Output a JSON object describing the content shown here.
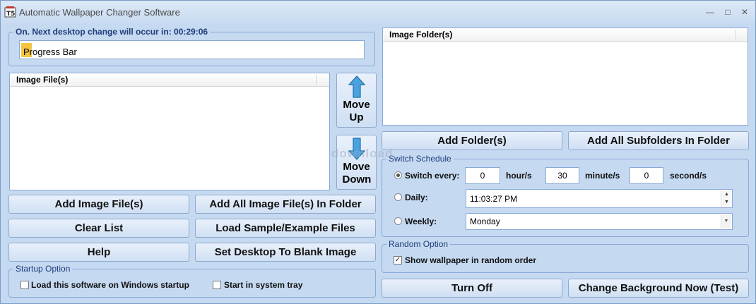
{
  "window": {
    "title": "Automatic Wallpaper Changer Software",
    "minimize_label": "—",
    "maximize_label": "□",
    "close_label": "✕"
  },
  "status_group": {
    "title": "On. Next desktop change will occur in: 00:29:06",
    "progress_text": "Progress Bar",
    "progress_fraction": 0.03
  },
  "image_files": {
    "header": "Image File(s)"
  },
  "move_buttons": {
    "up_label": "Move Up",
    "down_label": "Move Down"
  },
  "left_buttons": {
    "add_files": "Add Image File(s)",
    "add_all_in_folder": "Add All Image File(s) In Folder",
    "clear_list": "Clear List",
    "load_sample": "Load Sample/Example Files",
    "help": "Help",
    "set_blank": "Set Desktop To Blank Image"
  },
  "startup": {
    "title": "Startup Option",
    "load_on_startup_label": "Load this software on Windows startup",
    "load_on_startup_checked": false,
    "start_in_tray_label": "Start in system tray",
    "start_in_tray_checked": false
  },
  "image_folders": {
    "header": "Image Folder(s)"
  },
  "folder_buttons": {
    "add_folders": "Add Folder(s)",
    "add_subfolders": "Add All Subfolders In Folder"
  },
  "schedule": {
    "title": "Switch Schedule",
    "switch_every_label": "Switch every:",
    "hours_value": "0",
    "hours_unit": "hour/s",
    "minutes_value": "30",
    "minutes_unit": "minute/s",
    "seconds_value": "0",
    "seconds_unit": "second/s",
    "daily_label": "Daily:",
    "daily_time": "11:03:27 PM",
    "weekly_label": "Weekly:",
    "weekly_day": "Monday",
    "selected": "switch_every"
  },
  "random": {
    "title": "Random Option",
    "label": "Show wallpaper in random order",
    "checked": true
  },
  "bottom_buttons": {
    "turn_off": "Turn Off",
    "change_now": "Change Background Now (Test)"
  },
  "watermark": "download"
}
